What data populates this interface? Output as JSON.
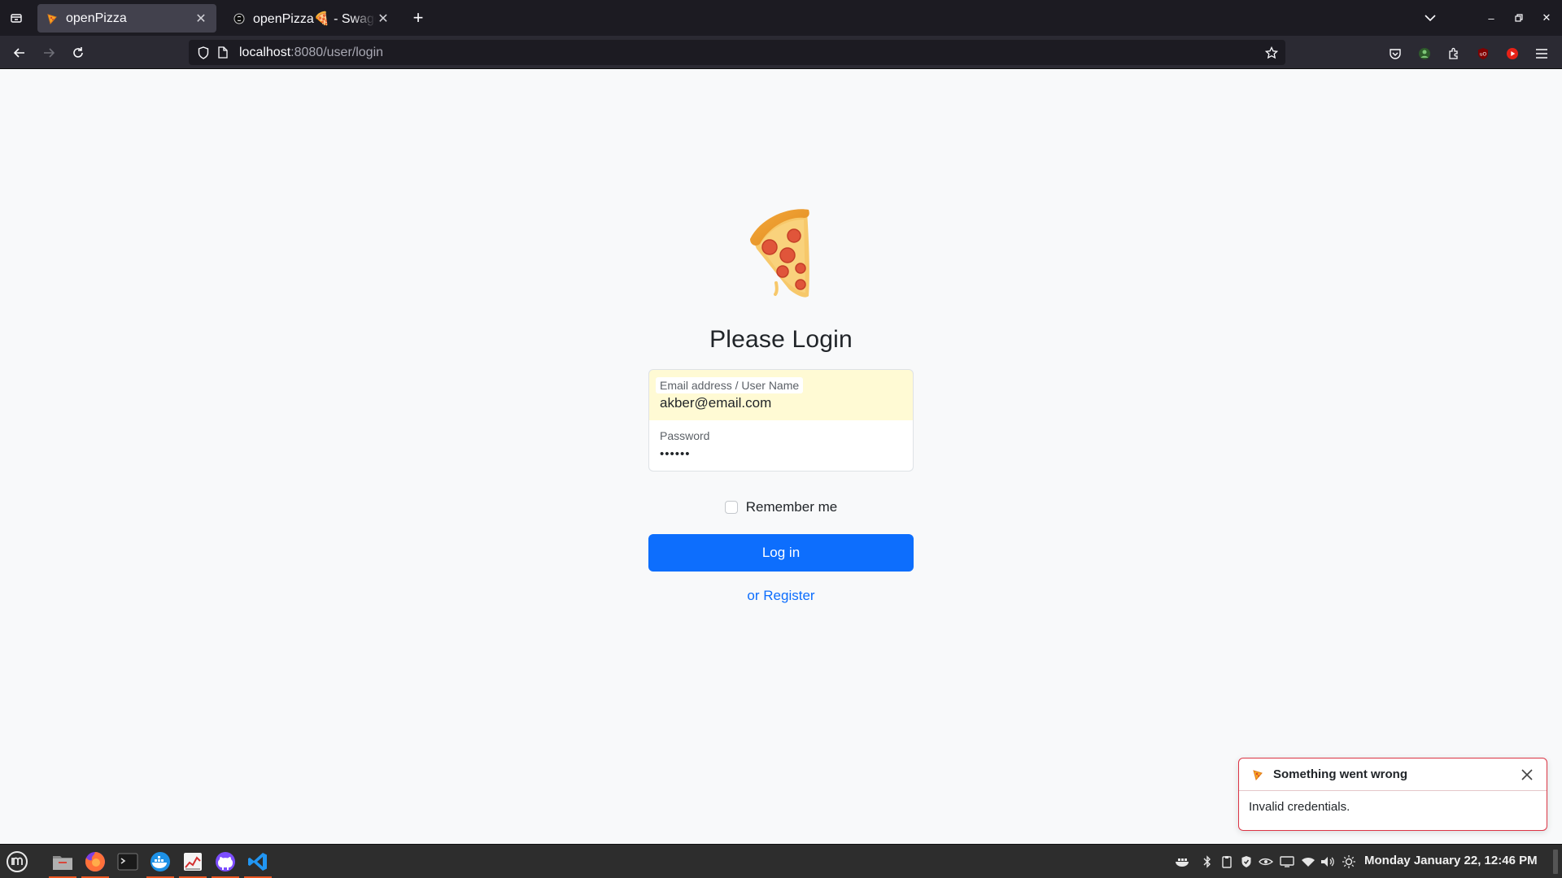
{
  "browser": {
    "tabs": [
      {
        "title": "openPizza",
        "active": true,
        "favicon": "pizza-icon"
      },
      {
        "title": "openPizza🍕 - Swagger UI",
        "active": false,
        "favicon": "swagger-icon"
      }
    ],
    "url_host": "localhost",
    "url_rest": ":8080/user/login"
  },
  "login": {
    "heading": "Please Login",
    "email_label": "Email address / User Name",
    "email_value": "akber@email.com",
    "password_label": "Password",
    "password_value": "••••••",
    "remember_label": "Remember me",
    "login_button": "Log in",
    "register_link": "or Register"
  },
  "toast": {
    "title": "Something went wrong",
    "message": "Invalid credentials.",
    "accent": "#dc3545"
  },
  "taskbar": {
    "apps": [
      "mint-menu",
      "files",
      "firefox",
      "terminal",
      "docker",
      "app-graph",
      "github-desktop",
      "vscode"
    ],
    "clock": "Monday January 22, 12:46 PM"
  },
  "colors": {
    "primary": "#0d6efd",
    "page_bg": "#f8f9fa",
    "autofill_bg": "#fffad4"
  }
}
